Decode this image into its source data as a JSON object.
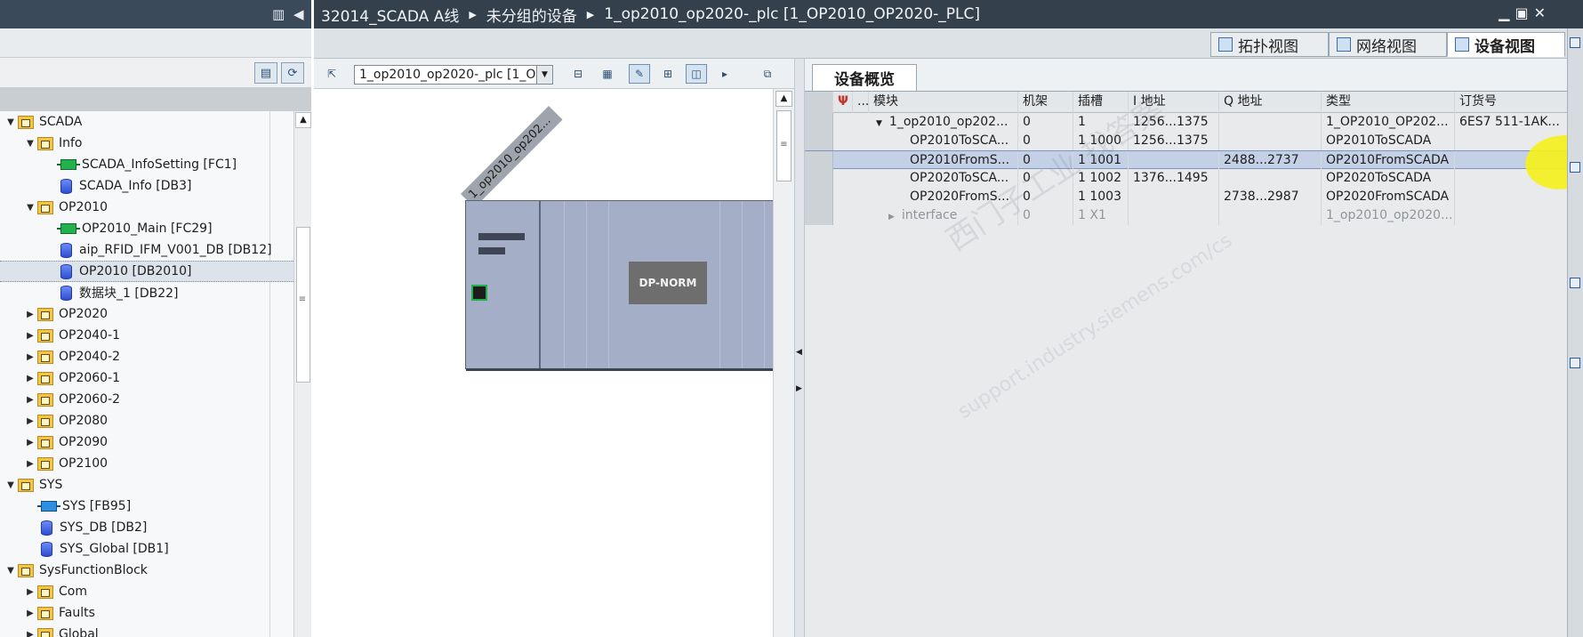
{
  "left_panel": {
    "tree": [
      {
        "label": "SCADA",
        "level": 0,
        "icon": "folder",
        "expanded": true
      },
      {
        "label": "Info",
        "level": 1,
        "icon": "folder",
        "expanded": true
      },
      {
        "label": "SCADA_InfoSetting [FC1]",
        "level": 2,
        "icon": "fc"
      },
      {
        "label": "SCADA_Info [DB3]",
        "level": 2,
        "icon": "db"
      },
      {
        "label": "OP2010",
        "level": 1,
        "icon": "folder",
        "expanded": true
      },
      {
        "label": "OP2010_Main [FC29]",
        "level": 2,
        "icon": "fc"
      },
      {
        "label": "aip_RFID_IFM_V001_DB [DB12]",
        "level": 2,
        "icon": "db"
      },
      {
        "label": "OP2010 [DB2010]",
        "level": 2,
        "icon": "db",
        "selected": true
      },
      {
        "label": "数据块_1 [DB22]",
        "level": 2,
        "icon": "db"
      },
      {
        "label": "OP2020",
        "level": 1,
        "icon": "folder",
        "expanded": false
      },
      {
        "label": "OP2040-1",
        "level": 1,
        "icon": "folder",
        "expanded": false
      },
      {
        "label": "OP2040-2",
        "level": 1,
        "icon": "folder",
        "expanded": false
      },
      {
        "label": "OP2060-1",
        "level": 1,
        "icon": "folder",
        "expanded": false
      },
      {
        "label": "OP2060-2",
        "level": 1,
        "icon": "folder",
        "expanded": false
      },
      {
        "label": "OP2080",
        "level": 1,
        "icon": "folder",
        "expanded": false
      },
      {
        "label": "OP2090",
        "level": 1,
        "icon": "folder",
        "expanded": false
      },
      {
        "label": "OP2100",
        "level": 1,
        "icon": "folder",
        "expanded": false
      },
      {
        "label": "SYS",
        "level": 0,
        "icon": "folder",
        "expanded": true
      },
      {
        "label": "SYS [FB95]",
        "level": 1,
        "icon": "fb"
      },
      {
        "label": "SYS_DB [DB2]",
        "level": 1,
        "icon": "db"
      },
      {
        "label": "SYS_Global [DB1]",
        "level": 1,
        "icon": "db"
      },
      {
        "label": "SysFunctionBlock",
        "level": 0,
        "icon": "folder",
        "expanded": true
      },
      {
        "label": "Com",
        "level": 1,
        "icon": "folder",
        "expanded": false
      },
      {
        "label": "Faults",
        "level": 1,
        "icon": "folder",
        "expanded": false
      },
      {
        "label": "Global",
        "level": 1,
        "icon": "folder",
        "expanded": false
      }
    ]
  },
  "breadcrumb": [
    "32014_SCADA  A线",
    "未分组的设备",
    "1_op2010_op2020-_plc [1_OP2010_OP2020-_PLC]"
  ],
  "view_tabs": [
    "拓扑视图",
    "网络视图",
    "设备视图"
  ],
  "device_view": {
    "selector_value": "1_op2010_op2020-_plc [1_O",
    "device_label": "1_op2010_op202...",
    "module_label": "DP-NORM"
  },
  "overview": {
    "tab_label": "设备概览",
    "columns": [
      "...",
      "模块",
      "机架",
      "插槽",
      "I 地址",
      "Q 地址",
      "类型",
      "订货号"
    ],
    "rows": [
      {
        "module": "1_op2010_op202...",
        "rack": "0",
        "slot": "1",
        "i_addr": "1256...1375",
        "q_addr": "",
        "type": "1_OP2010_OP202...",
        "order": "6ES7 511-1AK..."
      },
      {
        "module": "OP2010ToSCA...",
        "rack": "0",
        "slot": "1 1000",
        "i_addr": "1256...1375",
        "q_addr": "",
        "type": "OP2010ToSCADA",
        "order": ""
      },
      {
        "module": "OP2010FromS...",
        "rack": "0",
        "slot": "1 1001",
        "i_addr": "",
        "q_addr": "2488...2737",
        "type": "OP2010FromSCADA",
        "order": ""
      },
      {
        "module": "OP2020ToSCA...",
        "rack": "0",
        "slot": "1 1002",
        "i_addr": "1376...1495",
        "q_addr": "",
        "type": "OP2020ToSCADA",
        "order": ""
      },
      {
        "module": "OP2020FromS...",
        "rack": "0",
        "slot": "1 1003",
        "i_addr": "",
        "q_addr": "2738...2987",
        "type": "OP2020FromSCADA",
        "order": ""
      },
      {
        "module": "interface",
        "rack": "0",
        "slot": "1 X1",
        "i_addr": "",
        "q_addr": "",
        "type": "1_op2010_op2020...",
        "order": ""
      }
    ]
  },
  "watermark": [
    "西门子工业 找答案",
    "support.industry.siemens.com/cs"
  ],
  "colors": {
    "highlight": "#f5f01e",
    "title_bar": "#34404c",
    "selection": "#c3d0e6"
  }
}
